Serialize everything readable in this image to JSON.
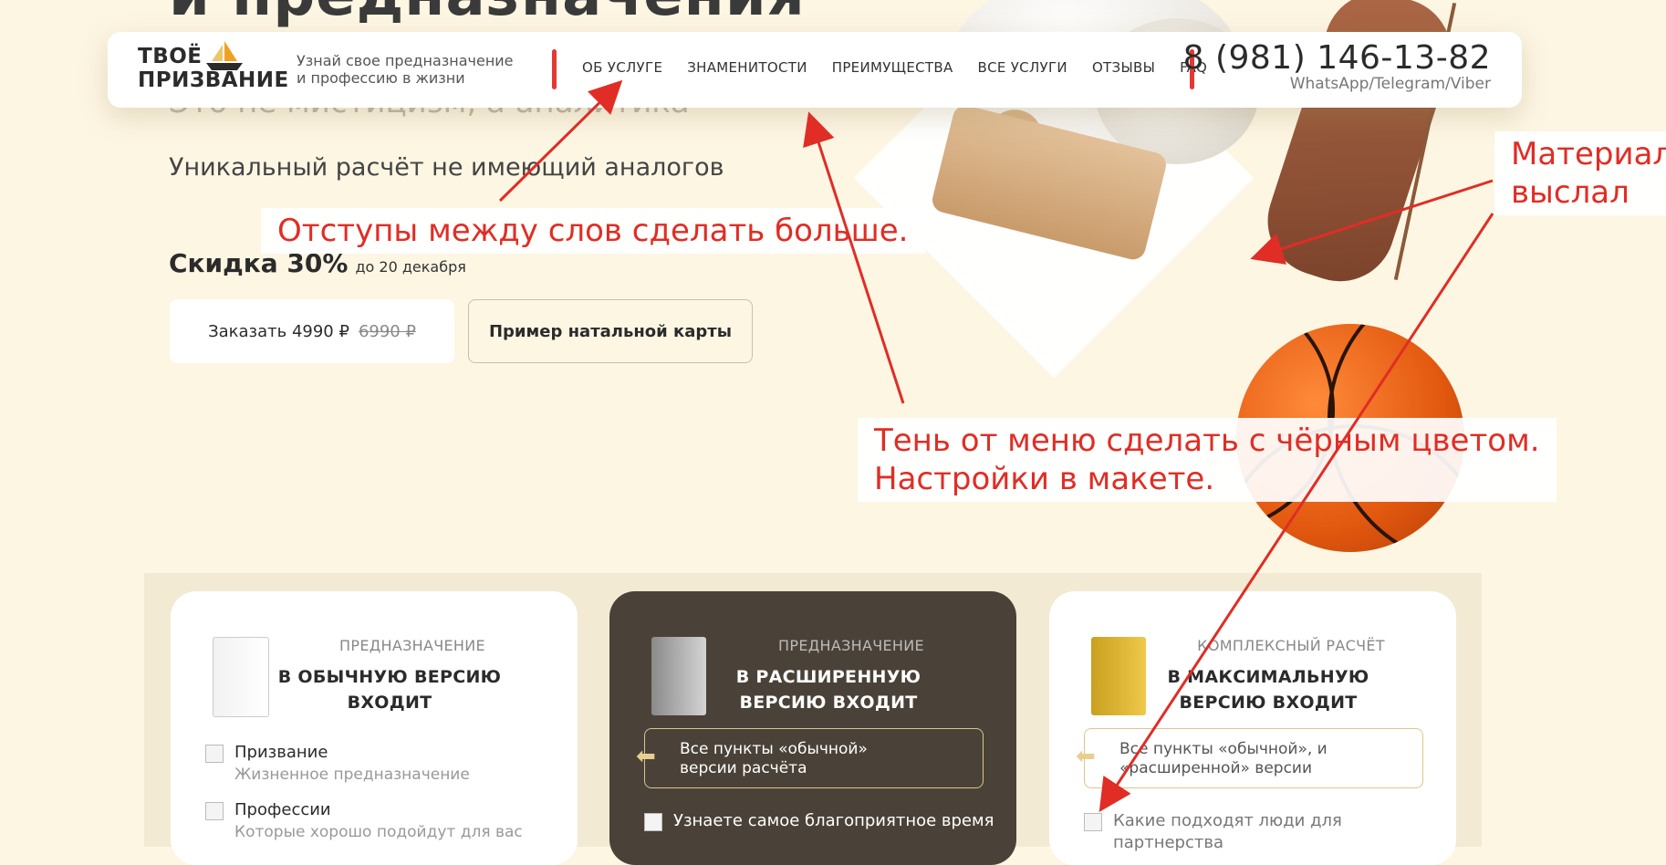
{
  "hero": {
    "title": "и предназначения",
    "subtitle_hidden": "Это не мистицизм, а аналитика",
    "unique": "Уникальный расчёт не имеющий аналогов",
    "discount_big": "Скидка 30%",
    "discount_small": "до 20 декабря",
    "order_label": "Заказать 4990 ₽",
    "order_old_price": "6990 ₽",
    "example_label": "Пример натальной карты"
  },
  "header": {
    "logo_line1": "ТВОЁ",
    "logo_line2": "ПРИЗВАНИЕ",
    "tagline_line1": "Узнай свое предназначение",
    "tagline_line2": "и профессию в жизни",
    "nav": [
      "ОБ УСЛУГЕ",
      "ЗНАМЕНИТОСТИ",
      "ПРЕИМУЩЕСТВА",
      "ВСЕ УСЛУГИ",
      "ОТЗЫВЫ",
      "FAQ"
    ],
    "phone": "8 (981) 146-13-82",
    "phone_sub": "WhatsApp/Telegram/Viber"
  },
  "annotations": {
    "spacing": "Отступы между слов сделать больше.",
    "shadow_line1": "Тень от меню сделать с чёрным цветом.",
    "shadow_line2": "Настройки в макете.",
    "material_line1": "Материал",
    "material_line2": "выслал",
    "color": "#e02d25"
  },
  "cards": [
    {
      "category": "ПРЕДНАЗНАЧЕНИЕ",
      "title_line1": "В ОБЫЧНУЮ ВЕРСИЮ",
      "title_line2": "ВХОДИТ",
      "features": [
        {
          "title": "Призвание",
          "sub": "Жизненное предназначение"
        },
        {
          "title": "Профессии",
          "sub": "Которые хорошо подойдут для вас"
        }
      ]
    },
    {
      "category": "ПРЕДНАЗНАЧЕНИЕ",
      "title_line1": "В РАСШИРЕННУЮ",
      "title_line2": "ВЕРСИЮ ВХОДИТ",
      "box_line1": "Все пункты «обычной»",
      "box_line2": "версии расчёта",
      "feature": "Узнаете самое благоприятное время"
    },
    {
      "category": "КОМПЛЕКСНЫЙ РАСЧЁТ",
      "title_line1": "В МАКСИМАЛЬНУЮ",
      "title_line2": "ВЕРСИЮ ВХОДИТ",
      "box_line1": "Все пункты «обычной», и",
      "box_line2": "«расширенной» версии",
      "feature": "Какие подходят люди для партнерства"
    }
  ],
  "colors": {
    "background": "#fdf6e3",
    "accent_red": "#e13a32",
    "dark_card": "#4a4238",
    "gold": "#e8cf8f"
  }
}
